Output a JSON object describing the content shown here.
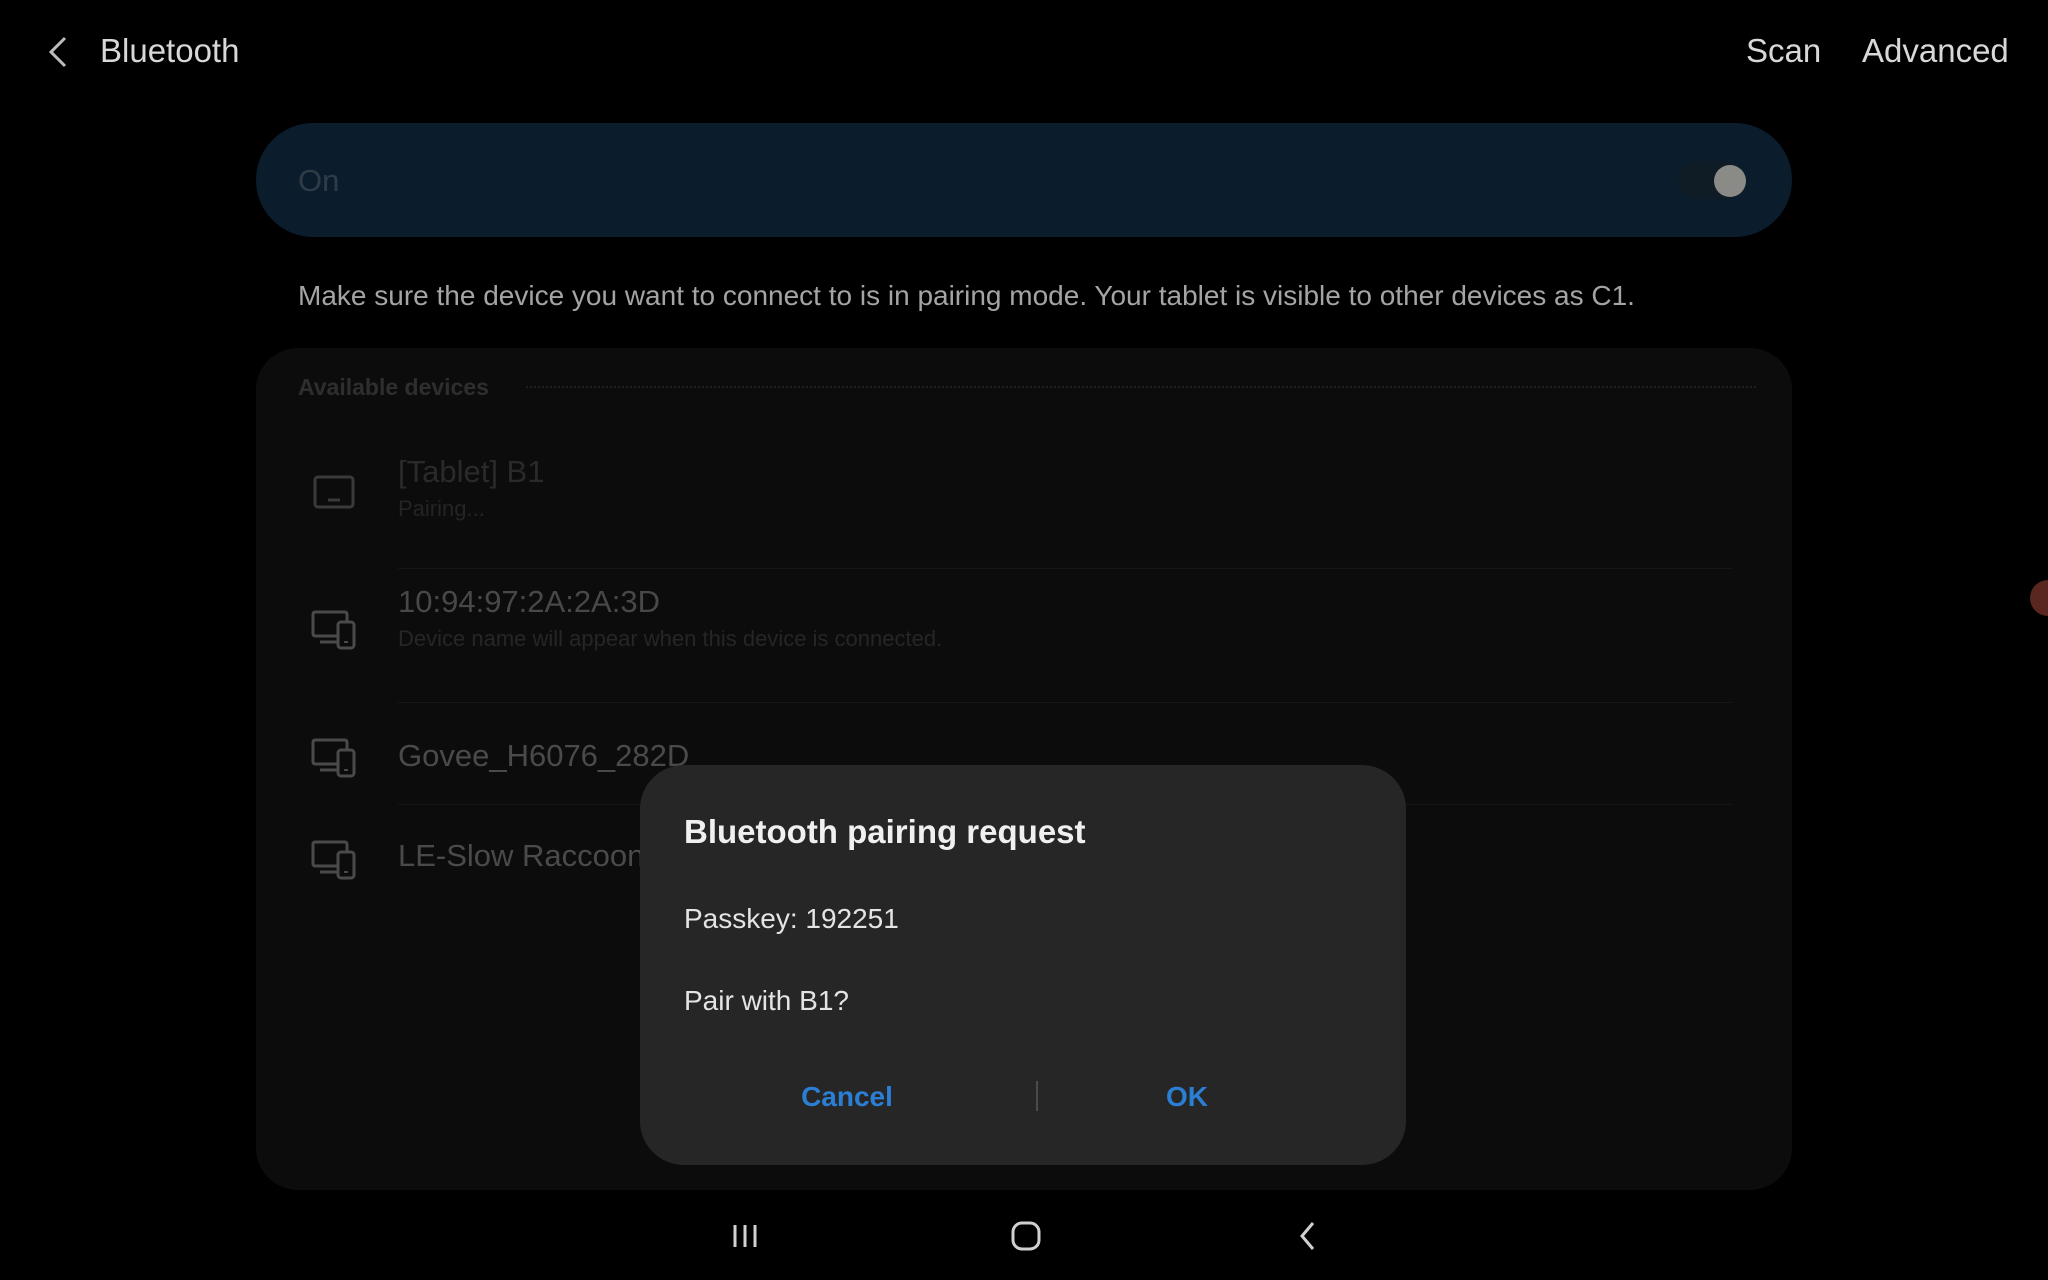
{
  "header": {
    "title": "Bluetooth",
    "scan_label": "Scan",
    "advanced_label": "Advanced"
  },
  "toggle": {
    "label": "On",
    "state": "on"
  },
  "hint": "Make sure the device you want to connect to is in pairing mode. Your tablet is visible to other devices as C1.",
  "devices": {
    "section_title": "Available devices",
    "items": [
      {
        "name": "[Tablet] B1",
        "status": "Pairing...",
        "icon": "tablet-icon"
      },
      {
        "name": "10:94:97:2A:2A:3D",
        "status": "Device name will appear when this device is connected.",
        "icon": "devices-icon"
      },
      {
        "name": "Govee_H6076_282D",
        "status": "",
        "icon": "devices-icon"
      },
      {
        "name": "LE-Slow Raccoon",
        "status": "",
        "icon": "devices-icon"
      }
    ]
  },
  "dialog": {
    "title": "Bluetooth pairing request",
    "passkey_line": "Passkey: 192251",
    "question": "Pair with B1?",
    "cancel_label": "Cancel",
    "ok_label": "OK"
  },
  "colors": {
    "accent": "#2a7fd4",
    "toggle_card": "#0b1d2c",
    "dialog_bg": "#262626"
  }
}
